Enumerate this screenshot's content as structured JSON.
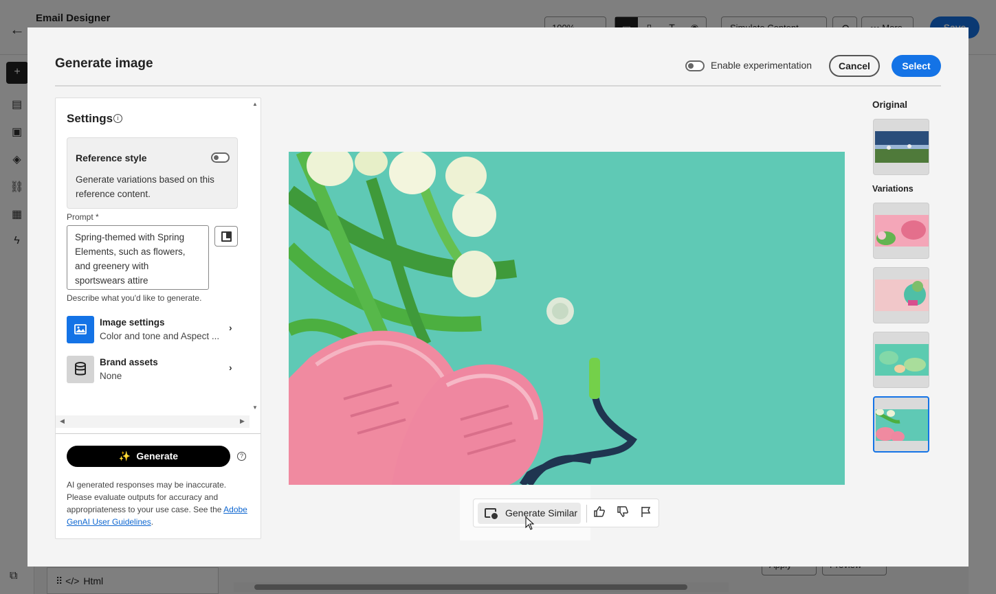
{
  "app": {
    "title": "Email Designer",
    "zoom": "100%",
    "simulate_label": "Simulate Content",
    "more_label": "More",
    "save_label": "Save",
    "bottom_component": "Html",
    "apply_label": "Apply",
    "preview_label": "Preview"
  },
  "modal": {
    "title": "Generate image",
    "enable_experimentation": "Enable experimentation",
    "enable_experimentation_on": false,
    "cancel_label": "Cancel",
    "select_label": "Select"
  },
  "settings": {
    "title": "Settings",
    "reference_style": {
      "title": "Reference style",
      "enabled": false,
      "description": "Generate variations based on this reference content."
    },
    "prompt": {
      "label": "Prompt",
      "required_marker": "*",
      "value": "Spring-themed with Spring Elements, such as flowers, and greenery with sportswears attire",
      "help": "Describe what you'd like to generate."
    },
    "image_settings": {
      "title": "Image settings",
      "subtitle": "Color and tone and Aspect ..."
    },
    "brand_assets": {
      "title": "Brand assets",
      "subtitle": "None"
    },
    "generate_label": "Generate",
    "disclaimer_text": "AI generated responses may be inaccurate. Please evaluate outputs for accuracy and appropriateness to your use case. See the ",
    "disclaimer_link": "Adobe GenAI User Guidelines",
    "disclaimer_end": "."
  },
  "actions": {
    "generate_similar": "Generate Similar",
    "icons": [
      "thumbs-up-icon",
      "thumbs-down-icon",
      "flag-icon"
    ]
  },
  "gallery": {
    "original_label": "Original",
    "variations_label": "Variations",
    "variation_count": 4,
    "selected_index": 3
  },
  "colors": {
    "accent": "#1473e6",
    "image_background": "#5fc9b5",
    "shoe_pink": "#f08aa0"
  }
}
